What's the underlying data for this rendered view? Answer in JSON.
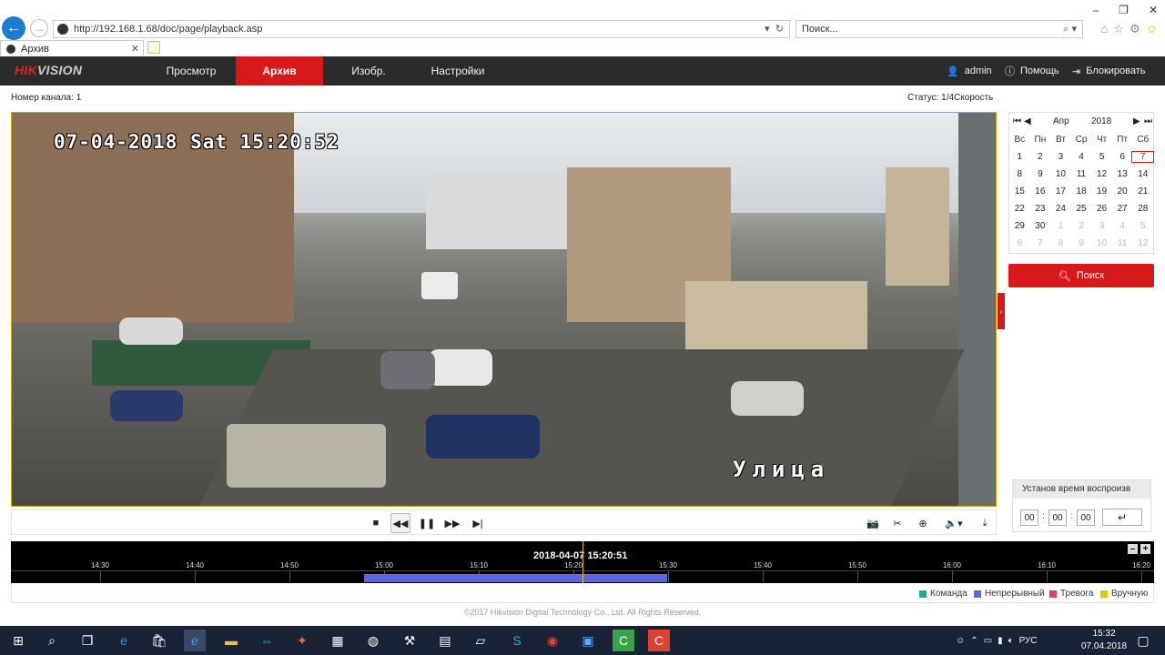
{
  "browser": {
    "url": "http://192.168.1.68/doc/page/playback.asp",
    "search_placeholder": "Поиск...",
    "tab_title": "Архив"
  },
  "header": {
    "logo_red": "HIK",
    "logo_grey": "VISION",
    "nav": [
      {
        "label": "Просмотр",
        "active": false
      },
      {
        "label": "Архив",
        "active": true
      },
      {
        "label": "Изобр.",
        "active": false
      },
      {
        "label": "Настройки",
        "active": false
      }
    ],
    "user": "admin",
    "help": "Помощь",
    "logout": "Блокировать"
  },
  "channel_label": "Номер канала: 1",
  "status_label": "Статус: 1/4Скорость",
  "video": {
    "osd_time": "07-04-2018 Sat 15:20:52",
    "osd_label": "Улица"
  },
  "calendar": {
    "month": "Апр",
    "year": "2018",
    "weekdays": [
      "Вс",
      "Пн",
      "Вт",
      "Ср",
      "Чт",
      "Пт",
      "Сб"
    ],
    "weeks": [
      [
        "1",
        "2",
        "3",
        "4",
        "5",
        "6",
        "7"
      ],
      [
        "8",
        "9",
        "10",
        "11",
        "12",
        "13",
        "14"
      ],
      [
        "15",
        "16",
        "17",
        "18",
        "19",
        "20",
        "21"
      ],
      [
        "22",
        "23",
        "24",
        "25",
        "26",
        "27",
        "28"
      ],
      [
        "29",
        "30",
        "1",
        "2",
        "3",
        "4",
        "5"
      ],
      [
        "6",
        "7",
        "8",
        "9",
        "10",
        "11",
        "12"
      ]
    ],
    "selected": "7"
  },
  "search_button": "Поиск",
  "timeset": {
    "title": "Установ время воспроизв",
    "hh": "00",
    "mm": "00",
    "ss": "00"
  },
  "timeline": {
    "current": "2018-04-07 15:20:51",
    "ticks": [
      "14:30",
      "14:40",
      "14:50",
      "15:00",
      "15:10",
      "15:20",
      "15:30",
      "15:40",
      "15:50",
      "16:00",
      "16:10",
      "16:20"
    ]
  },
  "legend": [
    {
      "label": "Команда",
      "color": "#1fae8e"
    },
    {
      "label": "Непрерывный",
      "color": "#5b67e3"
    },
    {
      "label": "Тревога",
      "color": "#e0416a"
    },
    {
      "label": "Вручную",
      "color": "#e8c400"
    }
  ],
  "copyright": "©2017 Hikvision Digital Technology Co., Ltd. All Rights Reserved.",
  "tray": {
    "lang": "РУС",
    "time": "15:32",
    "date": "07.04.2018"
  }
}
